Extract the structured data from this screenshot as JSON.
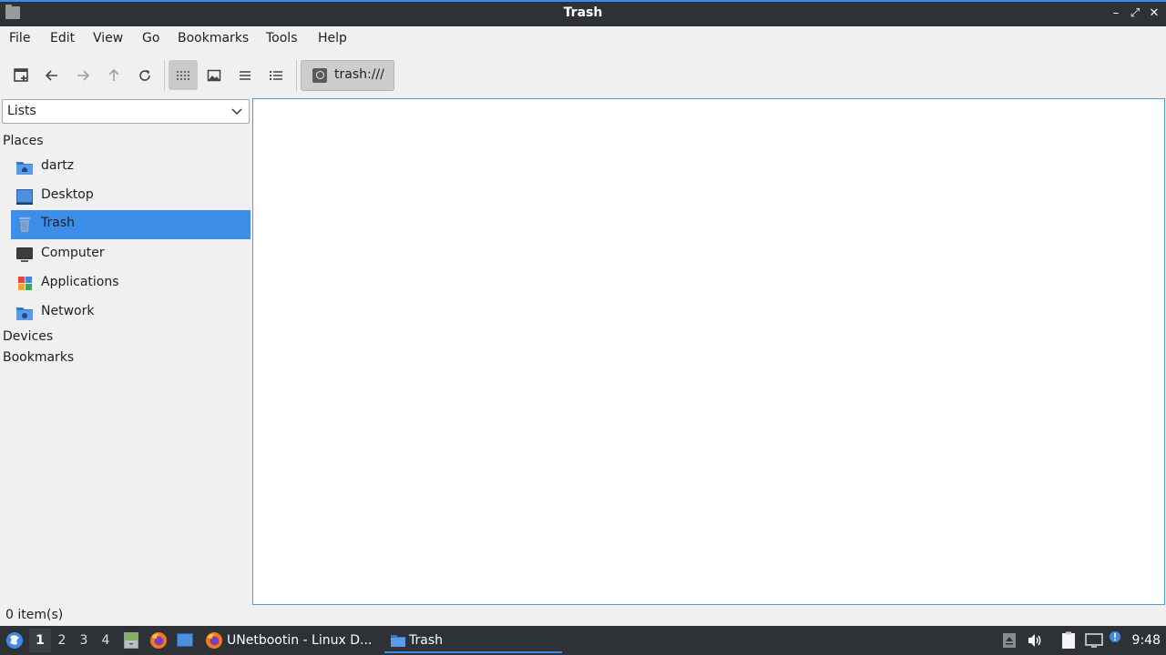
{
  "window": {
    "title": "Trash",
    "icon": "folder-icon"
  },
  "menubar": {
    "items": [
      "File",
      "Edit",
      "View",
      "Go",
      "Bookmarks",
      "Tools",
      "Help"
    ]
  },
  "toolbar": {
    "path": "trash:///"
  },
  "sidebar": {
    "mode": "Lists",
    "places_heading": "Places",
    "places": [
      {
        "label": "dartz",
        "icon": "home-folder-icon"
      },
      {
        "label": "Desktop",
        "icon": "desktop-icon"
      },
      {
        "label": "Trash",
        "icon": "trash-icon",
        "selected": true
      },
      {
        "label": "Computer",
        "icon": "computer-icon"
      },
      {
        "label": "Applications",
        "icon": "applications-icon"
      },
      {
        "label": "Network",
        "icon": "network-icon"
      }
    ],
    "devices_heading": "Devices",
    "bookmarks_heading": "Bookmarks"
  },
  "status": {
    "text": "0 item(s)"
  },
  "taskbar": {
    "workspaces": [
      "1",
      "2",
      "3",
      "4"
    ],
    "active_workspace": "1",
    "tasks": [
      {
        "label": "UNetbootin - Linux D...",
        "icon": "firefox-icon"
      },
      {
        "label": "Trash",
        "icon": "folder-icon",
        "active": true
      }
    ],
    "clock": "9:48"
  },
  "colors": {
    "selection": "#3d8ee8",
    "accent": "#3d8be6",
    "titlebar": "#2e3237"
  }
}
